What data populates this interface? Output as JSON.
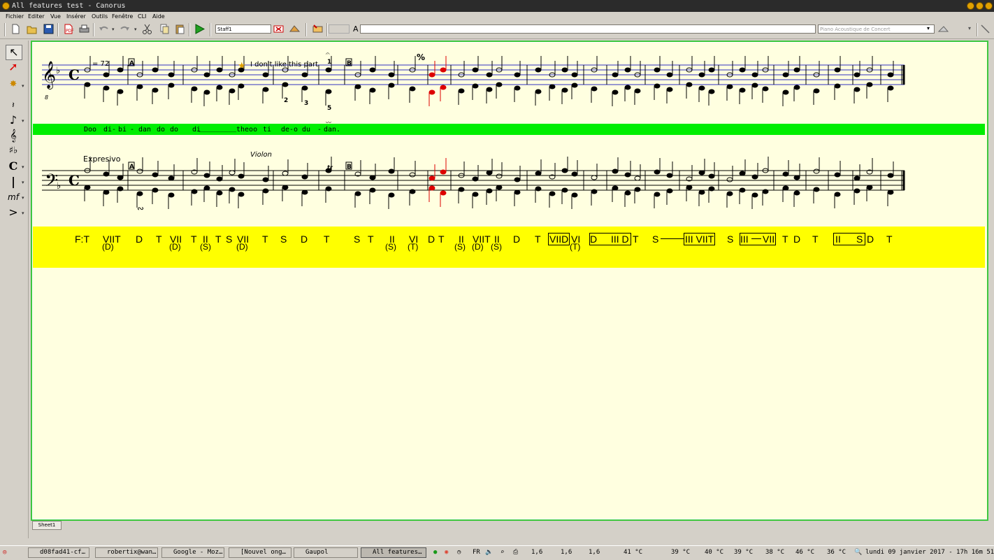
{
  "window": {
    "title": "All features test - Canorus"
  },
  "menu": [
    "Fichier",
    "Editer",
    "Vue",
    "Insérer",
    "Outils",
    "Fenêtre",
    "CLI",
    "Aide"
  ],
  "toolbar": {
    "staff_name": "Staff1",
    "text_field": "",
    "instrument": "Piano Acoustique de Concert"
  },
  "score": {
    "tempo": "= 72",
    "comment": "I don't like this part",
    "rehearsal_marks": [
      "A",
      "B",
      "A",
      "B"
    ],
    "fermata_number": "1",
    "fingerings": [
      "2",
      "3",
      "5"
    ],
    "segno": "%",
    "expression": "Expresivo",
    "instrument_change": "Violon",
    "trill": "tr",
    "clef_octave": "8",
    "lyrics": [
      "Doo",
      "di-",
      "bi",
      "-",
      "dan",
      "do",
      "do",
      "di",
      "_________",
      "theoo",
      "ti",
      "de-o",
      "du",
      "-",
      "dan."
    ],
    "functions": {
      "row1": [
        "F:T",
        "VIIT",
        "D",
        "T",
        "VII",
        "T",
        "II",
        "T",
        "S",
        "VII",
        "T",
        "S",
        "D",
        "T",
        "S",
        "T",
        "II",
        "VI",
        "D",
        "T",
        "II",
        "VIIT",
        "II",
        "D",
        "T",
        "VIID",
        "VI",
        "D",
        "III D",
        "T",
        "S",
        "III VIIT",
        "S",
        "III",
        "VII",
        "T",
        "D",
        "T",
        "II",
        "S",
        "D",
        "T"
      ],
      "row2": [
        "(D)",
        "(D)",
        "(S)",
        "(D)",
        "(S)",
        "(T)",
        "(S)",
        "(D)",
        "(S)",
        "(T)"
      ]
    }
  },
  "sheet_tab": "Sheet1",
  "taskbar": {
    "tasks": [
      "d08fad41-cf…",
      "robertix@wan…",
      "Google - Moz…",
      "[Nouvel ong…",
      "Gaupol",
      "All features…"
    ],
    "lang": "FR",
    "sensors": [
      "1,6",
      "1,6",
      "1,6",
      "41 °C",
      "39 °C",
      "40 °C",
      "39 °C",
      "38 °C",
      "46 °C",
      "36 °C"
    ],
    "clock": "lundi 09 janvier 2017 - 17h 16m 51s"
  },
  "colors": {
    "frame": "#3ec83e",
    "lyric_band": "#00ee00",
    "function_band": "#ffff00",
    "staff_line": "#3030c0",
    "paper": "#ffffe0"
  }
}
